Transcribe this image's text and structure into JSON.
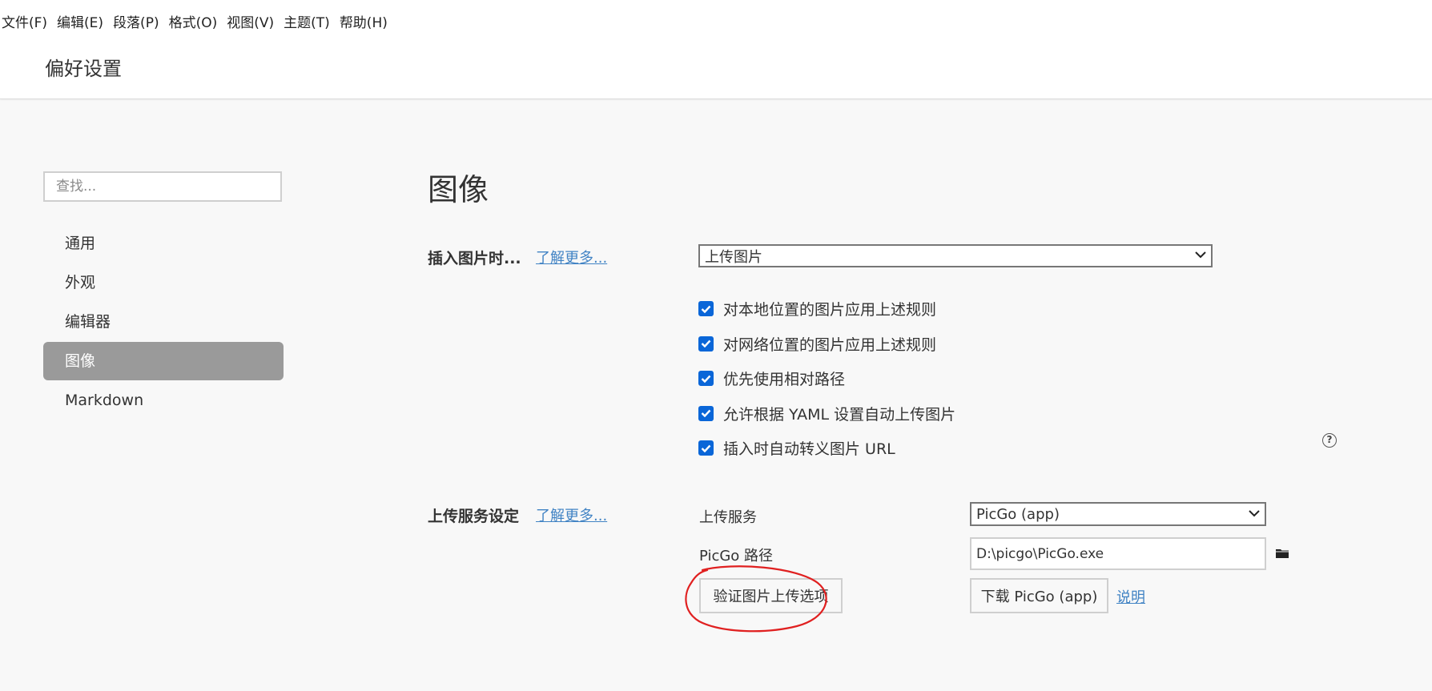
{
  "menubar": {
    "items": [
      "文件(F)",
      "编辑(E)",
      "段落(P)",
      "格式(O)",
      "视图(V)",
      "主题(T)",
      "帮助(H)"
    ]
  },
  "window": {
    "title": "偏好设置"
  },
  "sidebar": {
    "search_placeholder": "查找...",
    "items": [
      {
        "label": "通用"
      },
      {
        "label": "外观"
      },
      {
        "label": "编辑器"
      },
      {
        "label": "图像",
        "active": true
      },
      {
        "label": "Markdown"
      }
    ]
  },
  "main": {
    "heading": "图像",
    "insert_section": {
      "label": "插入图片时...",
      "learn_more": "了解更多...",
      "action_value": "上传图片",
      "checkboxes": [
        {
          "label": "对本地位置的图片应用上述规则",
          "checked": true
        },
        {
          "label": "对网络位置的图片应用上述规则",
          "checked": true
        },
        {
          "label": "优先使用相对路径",
          "checked": true
        },
        {
          "label": "允许根据 YAML 设置自动上传图片",
          "checked": true
        },
        {
          "label": "插入时自动转义图片 URL",
          "checked": true
        }
      ],
      "help_icon": "question-circle-icon"
    },
    "upload_section": {
      "label": "上传服务设定",
      "learn_more": "了解更多...",
      "service_label": "上传服务",
      "service_value": "PicGo (app)",
      "path_label": "PicGo 路径",
      "path_value": "D:\\picgo\\PicGo.exe",
      "verify_button": "验证图片上传选项",
      "download_button": "下载 PicGo (app)",
      "explain_link": "说明",
      "folder_icon": "folder-icon"
    }
  },
  "colors": {
    "accent": "#0a66d8",
    "link": "#4183c4",
    "active_nav": "#9a9a9a",
    "annotation": "#e02020"
  }
}
